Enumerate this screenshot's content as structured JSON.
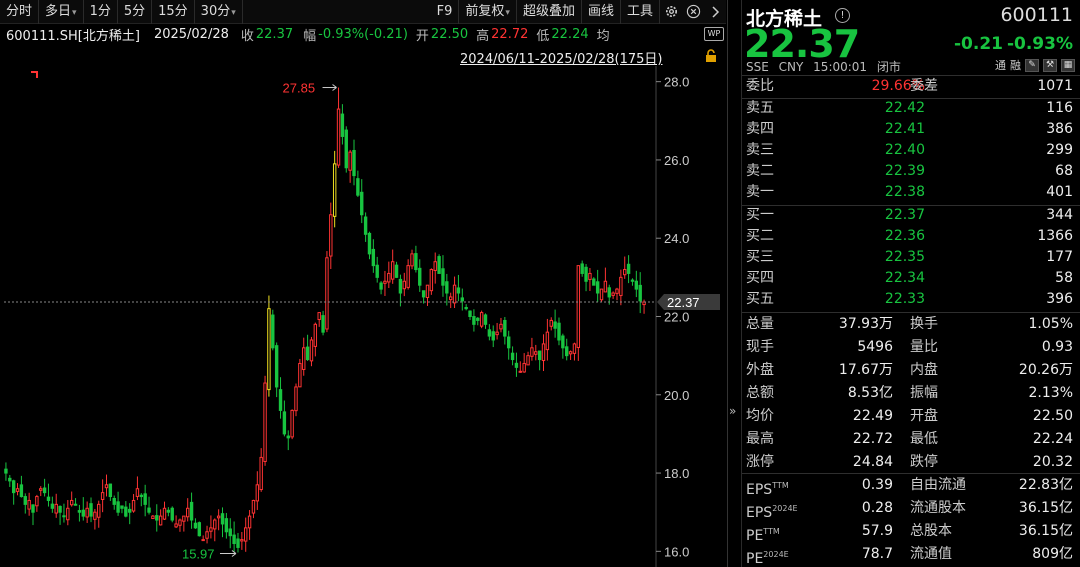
{
  "toolbar": {
    "periods": [
      "分时",
      "多日",
      "1分",
      "5分",
      "15分",
      "30分"
    ],
    "tools": [
      "F9",
      "前复权",
      "超级叠加",
      "画线",
      "工具"
    ]
  },
  "quote": {
    "code": "600111.SH[北方稀土]",
    "date": "2025/02/28",
    "close_label": "收",
    "close": "22.37",
    "amp_label": "幅",
    "amp": "-0.93%(-0.21)",
    "open_label": "开",
    "open": "22.50",
    "high_label": "高",
    "high": "22.72",
    "low_label": "低",
    "low": "22.24",
    "avg_label": "均",
    "wp": "WP"
  },
  "range": "2024/06/11-2025/02/28(175日)",
  "colors": {
    "up": "#ff3333",
    "down": "#18c440",
    "neutral": "#e6e6e6",
    "limit": "#f0e020",
    "bg": "#000000"
  },
  "chart_data": {
    "type": "candlestick",
    "ylim": [
      15.6,
      28.4
    ],
    "yticks": [
      "28.0",
      "26.0",
      "24.0",
      "22.0",
      "20.0",
      "18.0",
      "16.0"
    ],
    "ytick_values": [
      28,
      26,
      24,
      22,
      20,
      18,
      16
    ],
    "annotations": {
      "high": "27.85",
      "low": "15.97",
      "last": "22.37"
    },
    "high_value": 27.85,
    "low_value": 15.97,
    "last_value": 22.37,
    "closes": [
      18.0,
      17.8,
      17.5,
      17.6,
      17.4,
      17.2,
      17.3,
      17.0,
      17.4,
      17.6,
      17.5,
      17.3,
      17.1,
      17.2,
      17.0,
      16.9,
      17.1,
      17.3,
      17.2,
      17.0,
      16.9,
      17.1,
      16.9,
      17.0,
      17.2,
      17.5,
      17.7,
      17.4,
      17.2,
      17.0,
      17.1,
      16.9,
      17.0,
      17.3,
      17.6,
      17.4,
      17.2,
      17.0,
      16.9,
      16.8,
      16.9,
      17.1,
      17.0,
      16.8,
      16.7,
      16.8,
      16.9,
      17.1,
      16.8,
      16.6,
      16.4,
      16.3,
      16.5,
      16.6,
      16.8,
      16.9,
      16.7,
      16.5,
      16.4,
      16.2,
      16.1,
      16.3,
      16.6,
      16.9,
      17.3,
      17.7,
      18.4,
      20.3,
      22.2,
      21.2,
      20.2,
      19.6,
      19.0,
      18.9,
      19.6,
      20.2,
      20.8,
      21.2,
      20.9,
      21.4,
      21.8,
      22.1,
      21.6,
      23.5,
      24.6,
      25.9,
      27.3,
      26.6,
      25.8,
      26.2,
      25.6,
      25.1,
      24.6,
      24.1,
      23.6,
      23.3,
      23.0,
      22.7,
      22.9,
      23.1,
      23.4,
      23.0,
      22.6,
      22.9,
      23.3,
      23.6,
      23.2,
      22.8,
      22.5,
      22.8,
      23.2,
      23.4,
      23.1,
      22.8,
      22.6,
      22.5,
      22.8,
      22.6,
      22.4,
      22.2,
      22.0,
      21.8,
      21.9,
      22.1,
      21.8,
      21.5,
      21.4,
      21.6,
      21.8,
      21.5,
      21.2,
      20.9,
      20.7,
      20.6,
      20.8,
      21.0,
      21.2,
      21.1,
      20.9,
      21.3,
      21.6,
      21.9,
      21.7,
      21.4,
      21.2,
      21.0,
      21.1,
      21.3,
      23.3,
      23.1,
      22.9,
      23.1,
      22.8,
      22.6,
      22.7,
      22.9,
      22.5,
      22.6,
      22.7,
      23.0,
      23.2,
      23.1,
      22.9,
      22.7,
      22.4,
      22.37
    ],
    "limit_up_indices": [
      68,
      85
    ]
  },
  "panel": {
    "name": "北方稀土",
    "code": "600111",
    "price": "22.37",
    "change": "-0.21",
    "change_pct": "-0.93%",
    "exchange": "SSE",
    "currency": "CNY",
    "time": "15:00:01",
    "status": "闭市",
    "tag1": "通",
    "tag2": "融",
    "weibi_label": "委比",
    "weibi": "29.66%",
    "weicha_label": "委差",
    "weicha": "1071",
    "asks": [
      {
        "label": "卖五",
        "price": "22.42",
        "vol": "116"
      },
      {
        "label": "卖四",
        "price": "22.41",
        "vol": "386"
      },
      {
        "label": "卖三",
        "price": "22.40",
        "vol": "299"
      },
      {
        "label": "卖二",
        "price": "22.39",
        "vol": "68"
      },
      {
        "label": "卖一",
        "price": "22.38",
        "vol": "401"
      }
    ],
    "bids": [
      {
        "label": "买一",
        "price": "22.37",
        "vol": "344"
      },
      {
        "label": "买二",
        "price": "22.36",
        "vol": "1366"
      },
      {
        "label": "买三",
        "price": "22.35",
        "vol": "177"
      },
      {
        "label": "买四",
        "price": "22.34",
        "vol": "58"
      },
      {
        "label": "买五",
        "price": "22.33",
        "vol": "396"
      }
    ],
    "stats": [
      {
        "k1": "总量",
        "v1": "37.93万",
        "k2": "换手",
        "v2": "1.05%"
      },
      {
        "k1": "现手",
        "v1": "5496",
        "k2": "量比",
        "v2": "0.93"
      },
      {
        "k1": "外盘",
        "v1": "17.67万",
        "k2": "内盘",
        "v2": "20.26万"
      },
      {
        "k1": "总额",
        "v1": "8.53亿",
        "k2": "振幅",
        "v2": "2.13%"
      },
      {
        "k1": "均价",
        "v1": "22.49",
        "k2": "开盘",
        "v2": "22.50"
      },
      {
        "k1": "最高",
        "v1": "22.72",
        "k2": "最低",
        "v2": "22.24"
      },
      {
        "k1": "涨停",
        "v1": "24.84",
        "k2": "跌停",
        "v2": "20.32"
      }
    ],
    "fund": [
      {
        "k1": "EPS",
        "s1": "TTM",
        "v1": "0.39",
        "k2": "自由流通",
        "v2": "22.83亿"
      },
      {
        "k1": "EPS",
        "s1": "2024E",
        "v1": "0.28",
        "k2": "流通股本",
        "v2": "36.15亿"
      },
      {
        "k1": "PE",
        "s1": "TTM",
        "v1": "57.9",
        "k2": "总股本",
        "v2": "36.15亿"
      },
      {
        "k1": "PE",
        "s1": "2024E",
        "v1": "78.7",
        "k2": "流通值",
        "v2": "809亿"
      }
    ]
  }
}
